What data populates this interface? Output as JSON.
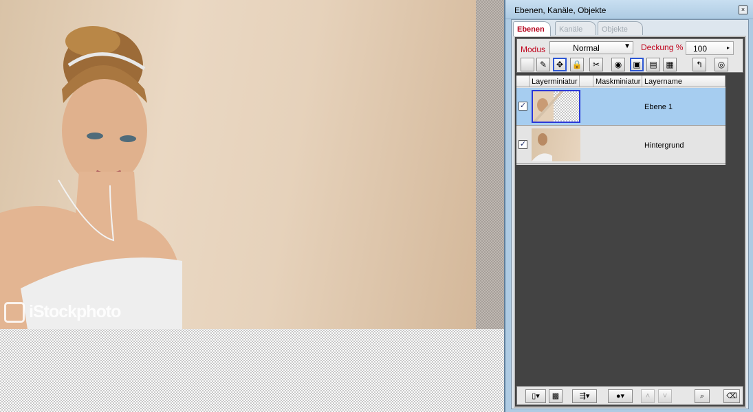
{
  "panel": {
    "title": "Ebenen, Kanäle, Objekte",
    "close_icon": "close-icon",
    "tabs": [
      {
        "label": "Ebenen",
        "active": true
      },
      {
        "label": "Kanäle",
        "active": false
      },
      {
        "label": "Objekte",
        "active": false
      }
    ]
  },
  "toolbar": {
    "modus_label": "Modus",
    "modus_value": "Normal",
    "deckung_label": "Deckung %",
    "deckung_value": "100",
    "tools": [
      "transparency-lock-icon",
      "brush-lock-icon",
      "move-icon",
      "lock-icon",
      "scissors-icon",
      "eye-icon",
      "image-icon",
      "image-mask-icon",
      "document-icon",
      "swap-icon",
      "eye-outline-icon"
    ]
  },
  "layers_table": {
    "headers": [
      "Layerminiatur",
      "Maskminiatur",
      "Layername"
    ],
    "rows": [
      {
        "name": "Ebene 1",
        "visible": true,
        "selected": true
      },
      {
        "name": "Hintergrund",
        "visible": true,
        "selected": false
      }
    ]
  },
  "canvas": {
    "watermark": "iStockphoto"
  },
  "bottom_bar": {
    "buttons": [
      "new-layer-icon",
      "mask-icon",
      "blend-icon",
      "circle-icon",
      "up-icon",
      "down-icon",
      "zoom-icon",
      "trash-icon"
    ]
  },
  "colors": {
    "accent_red": "#c0001a",
    "selected_row": "#a6cdf0",
    "panel_bg": "#434343"
  }
}
